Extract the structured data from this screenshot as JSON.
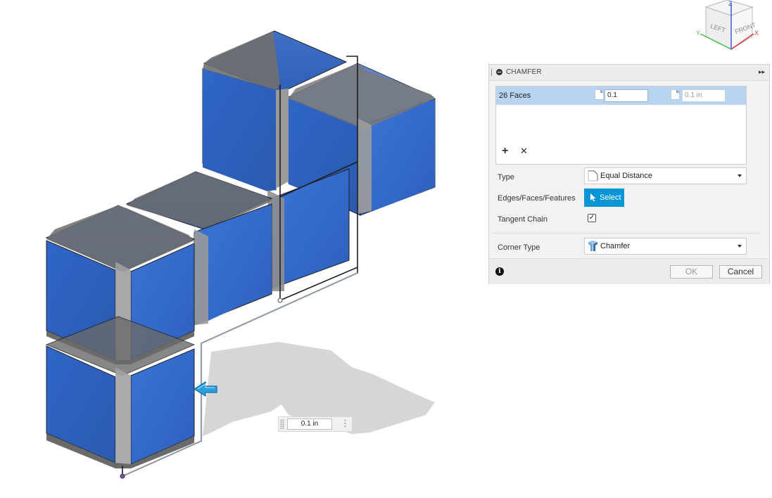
{
  "dialog": {
    "title": "CHAMFER",
    "selection": {
      "label": "26 Faces",
      "distance_value": "0.1",
      "distance2_placeholder": "0.1 in"
    },
    "type_label": "Type",
    "type_value": "Equal Distance",
    "edges_label": "Edges/Faces/Features",
    "select_label": "Select",
    "tangent_label": "Tangent Chain",
    "tangent_checked": "✓",
    "corner_label": "Corner Type",
    "corner_value": "Chamfer",
    "ok_label": "OK",
    "cancel_label": "Cancel"
  },
  "canvas": {
    "dimension_value": "0.1 in"
  },
  "viewcube": {
    "left": "LEFT",
    "front": "FRONT",
    "x": "X",
    "y": "Y",
    "z": "Z"
  },
  "colors": {
    "cube_face": "#3268c4",
    "chamfer": "#7a7a7a",
    "select_button": "#0696d7",
    "highlight_row": "#b9d4f0"
  }
}
